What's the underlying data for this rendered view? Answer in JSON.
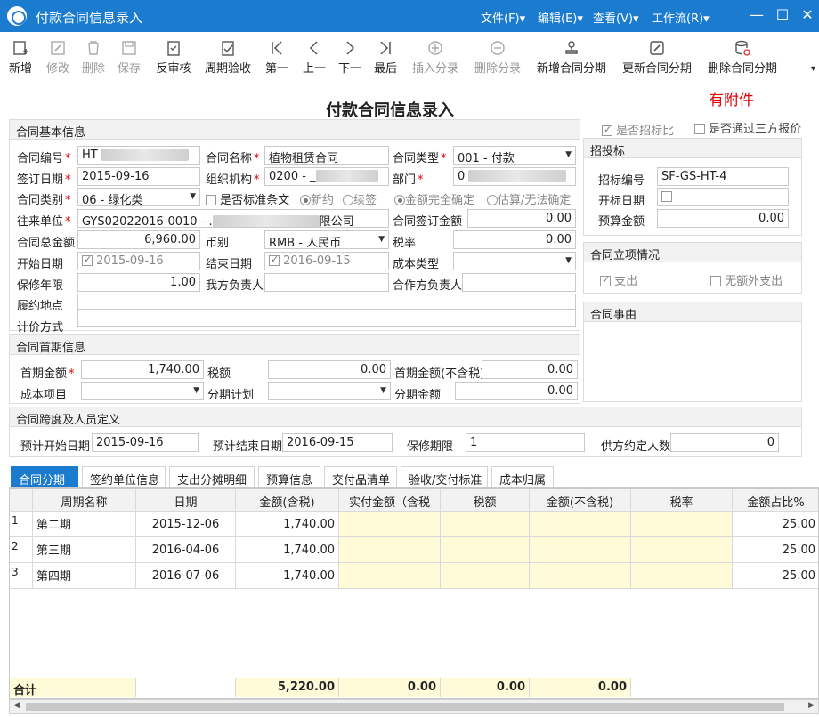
{
  "window": {
    "title": "付款合同信息录入",
    "menus": [
      "文件(F)▾",
      "编辑(E)▾",
      "查看(V)▾",
      "工作流(R)▾"
    ]
  },
  "toolbar": {
    "buttons": [
      "新增",
      "修改",
      "删除",
      "保存",
      "反审核",
      "周期验收",
      "第一",
      "上一",
      "下一",
      "最后",
      "插入分录",
      "删除分录",
      "新增合同分期",
      "更新合同分期",
      "删除合同分期"
    ]
  },
  "form": {
    "title": "付款合同信息录入",
    "attachment": "有附件"
  },
  "basic": {
    "header": "合同基本信息",
    "contract_no_label": "合同编号",
    "contract_no": "HT",
    "contract_name_label": "合同名称",
    "contract_name": "植物租赁合同",
    "contract_type_label": "合同类型",
    "contract_type": "001 - 付款",
    "sign_date_label": "签订日期",
    "sign_date": "2015-09-16",
    "org_label": "组织机构",
    "org": "0200 - _",
    "dept_label": "部门",
    "dept": "0",
    "category_label": "合同类别",
    "category": "06 - 绿化类",
    "std_terms": "是否标准条文",
    "new_sign": "新约",
    "renew": "续签",
    "amount_fixed": "金额完全确定",
    "amount_est": "估算/无法确定",
    "partner_label": "往来单位",
    "partner_prefix": "GYS02022016-0010 - .",
    "partner_suffix": "限公司",
    "sign_amount_label": "合同签订金额",
    "sign_amount": "0.00",
    "total_label": "合同总金额",
    "total": "6,960.00",
    "currency_label": "币别",
    "currency": "RMB - 人民币",
    "tax_label": "税率",
    "tax": "0.00",
    "start_label": "开始日期",
    "start": "2015-09-16",
    "end_label": "结束日期",
    "end": "2016-09-15",
    "cost_type_label": "成本类型",
    "cost_type": "",
    "warranty_label": "保修年限",
    "warranty": "1.00",
    "our_rep_label": "我方负责人",
    "our_rep": "",
    "partner_rep_label": "合作方负责人",
    "partner_rep": "",
    "place_label": "履约地点",
    "place": "",
    "pricing_label": "计价方式",
    "pricing": ""
  },
  "right": {
    "is_bid": "是否招标比",
    "third_party": "是否通过三方报价",
    "bid_header": "招投标",
    "bid_no_label": "招标编号",
    "bid_no": "SF-GS-HT-4",
    "bid_date_label": "开标日期",
    "budget_label": "预算金额",
    "budget": "0.00",
    "setup_header": "合同立项情况",
    "expense": "支出",
    "no_extra": "无额外支出",
    "reason_header": "合同事由"
  },
  "first_payment": {
    "header": "合同首期信息",
    "amount_label": "首期金额",
    "amount": "1,740.00",
    "tax_label": "税额",
    "tax": "0.00",
    "amount_notax_label": "首期金额(不含税)",
    "amount_notax": "0.00",
    "cost_item_label": "成本项目",
    "plan_label": "分期计划",
    "inst_amount_label": "分期金额",
    "inst_amount": "0.00"
  },
  "span": {
    "header": "合同跨度及人员定义",
    "start_label": "预计开始日期",
    "start": "2015-09-16",
    "end_label": "预计结束日期",
    "end": "2016-09-15",
    "warranty_label": "保修期限",
    "warranty": "1",
    "count_label": "供方约定人数",
    "count": "0"
  },
  "tabs": [
    "合同分期",
    "签约单位信息",
    "支出分摊明细",
    "预算信息",
    "交付品清单",
    "验收/交付标准",
    "成本归属"
  ],
  "grid": {
    "columns": [
      "周期名称",
      "日期",
      "金额(含税)",
      "实付金额（含税",
      "税额",
      "金额(不含税)",
      "税率",
      "金额占比%"
    ],
    "rows": [
      {
        "no": "1",
        "name": "第二期",
        "date": "2015-12-06",
        "amount": "1,740.00",
        "pct": "25.00"
      },
      {
        "no": "2",
        "name": "第三期",
        "date": "2016-04-06",
        "amount": "1,740.00",
        "pct": "25.00"
      },
      {
        "no": "3",
        "name": "第四期",
        "date": "2016-07-06",
        "amount": "1,740.00",
        "pct": "25.00"
      }
    ],
    "total_label": "合计",
    "total_amount": "5,220.00",
    "total_paid": "0.00",
    "total_tax": "0.00",
    "total_notax": "0.00"
  }
}
